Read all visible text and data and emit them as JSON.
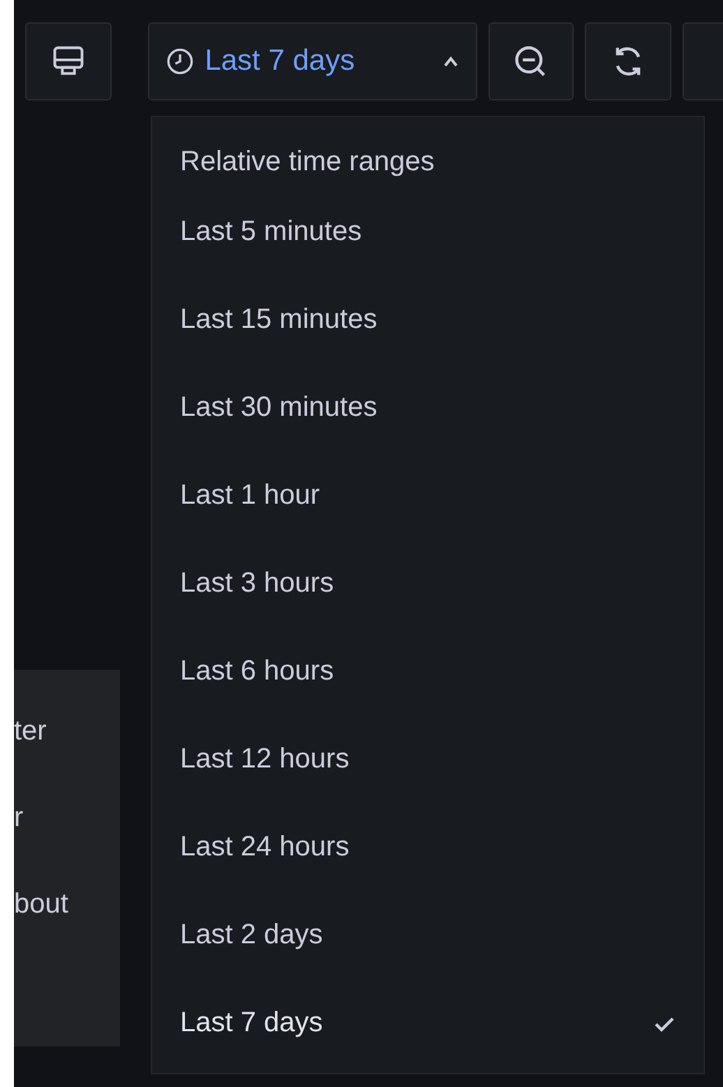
{
  "toolbar": {
    "time_range": {
      "label": "Last 7 days",
      "expanded": true
    }
  },
  "time_menu": {
    "heading": "Relative time ranges",
    "options": [
      {
        "label": "Last 5 minutes",
        "selected": false
      },
      {
        "label": "Last 15 minutes",
        "selected": false
      },
      {
        "label": "Last 30 minutes",
        "selected": false
      },
      {
        "label": "Last 1 hour",
        "selected": false
      },
      {
        "label": "Last 3 hours",
        "selected": false
      },
      {
        "label": "Last 6 hours",
        "selected": false
      },
      {
        "label": "Last 12 hours",
        "selected": false
      },
      {
        "label": "Last 24 hours",
        "selected": false
      },
      {
        "label": "Last 2 days",
        "selected": false
      },
      {
        "label": "Last 7 days",
        "selected": true
      }
    ]
  },
  "side_menu": {
    "items": [
      "ter",
      "r",
      "bout"
    ]
  }
}
